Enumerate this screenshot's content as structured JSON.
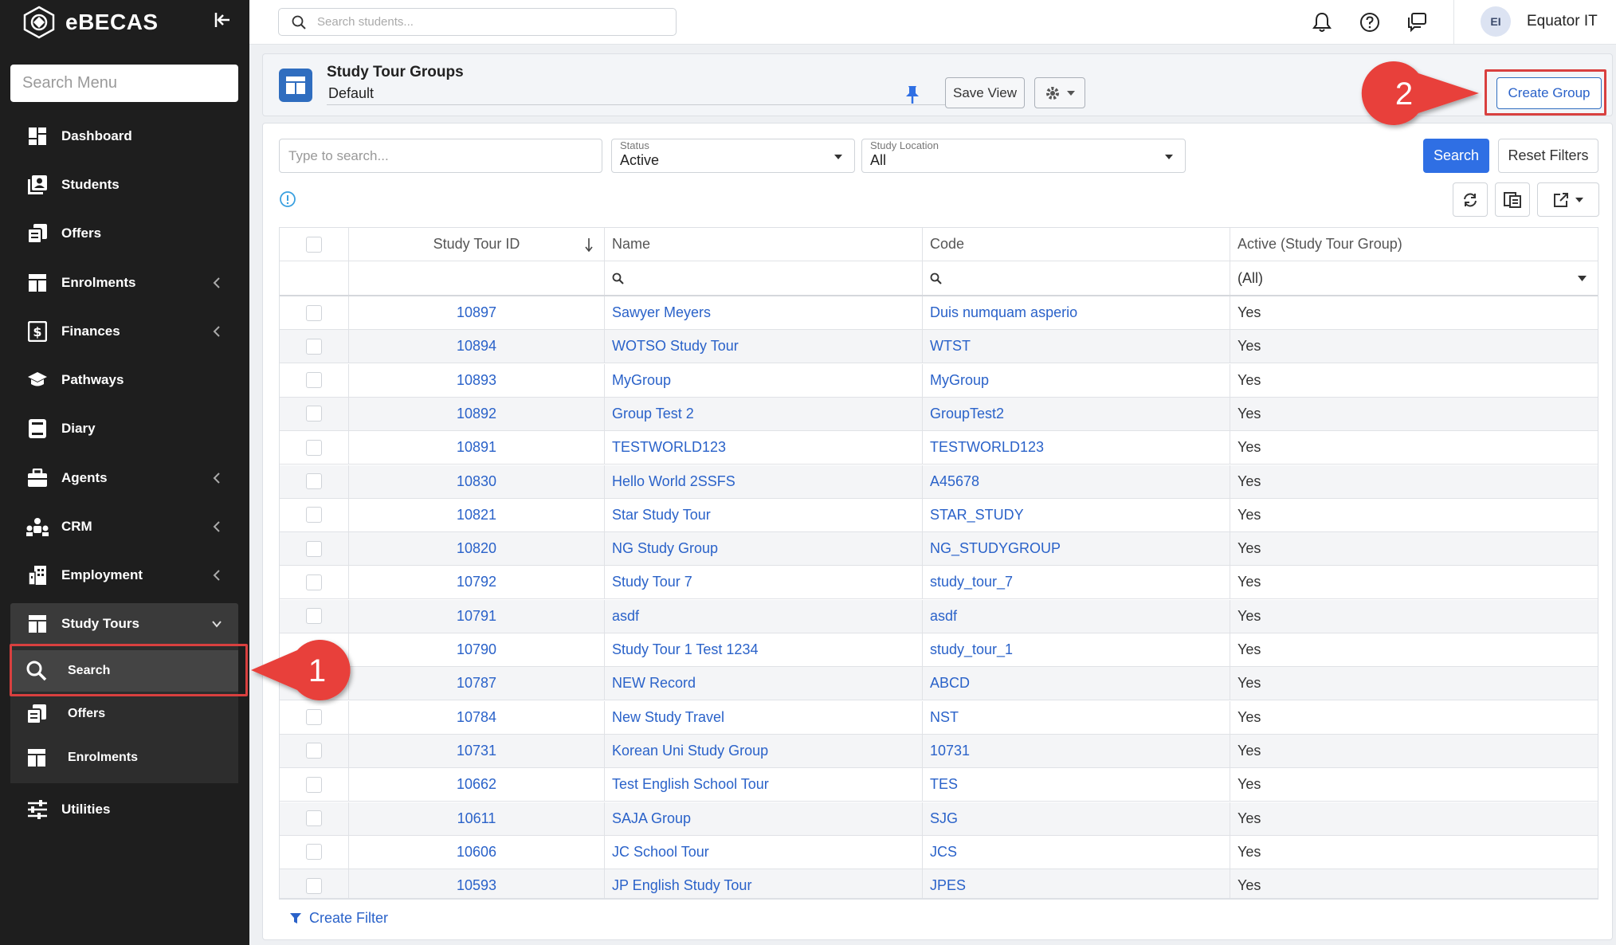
{
  "app": {
    "brand_name": "eBECAS",
    "menu_search_placeholder": "Search Menu"
  },
  "sidebar": {
    "items": [
      {
        "label": "Dashboard",
        "icon": "dashboard-icon"
      },
      {
        "label": "Students",
        "icon": "students-icon"
      },
      {
        "label": "Offers",
        "icon": "offers-icon"
      },
      {
        "label": "Enrolments",
        "icon": "enrolments-icon",
        "expandable": true
      },
      {
        "label": "Finances",
        "icon": "finances-icon",
        "expandable": true
      },
      {
        "label": "Pathways",
        "icon": "graduation-cap-icon"
      },
      {
        "label": "Diary",
        "icon": "diary-icon"
      },
      {
        "label": "Agents",
        "icon": "briefcase-icon",
        "expandable": true
      },
      {
        "label": "CRM",
        "icon": "crm-icon",
        "expandable": true
      },
      {
        "label": "Employment",
        "icon": "building-icon",
        "expandable": true
      },
      {
        "label": "Study Tours",
        "icon": "study-tours-icon",
        "expanded": true
      },
      {
        "label": "Utilities",
        "icon": "sliders-icon"
      }
    ],
    "study_tours_sub": [
      {
        "label": "Search",
        "icon": "search-icon",
        "active": true
      },
      {
        "label": "Offers",
        "icon": "offers-icon"
      },
      {
        "label": "Enrolments",
        "icon": "enrolments-icon"
      }
    ]
  },
  "topbar": {
    "search_placeholder": "Search students...",
    "user_initials": "EI",
    "user_name": "Equator IT"
  },
  "header": {
    "title": "Study Tour Groups",
    "view_name": "Default",
    "save_view_label": "Save View",
    "create_group_label": "Create Group"
  },
  "filters": {
    "search_placeholder": "Type to search...",
    "status_label": "Status",
    "status_value": "Active",
    "location_label": "Study Location",
    "location_value": "All",
    "search_button": "Search",
    "reset_button": "Reset Filters"
  },
  "grid": {
    "columns": [
      "Study Tour ID",
      "Name",
      "Code",
      "Active (Study Tour Group)"
    ],
    "active_filter_value": "(All)",
    "rows": [
      {
        "id": "10897",
        "name": "Sawyer Meyers",
        "code": "Duis numquam asperio",
        "active": "Yes"
      },
      {
        "id": "10894",
        "name": "WOTSO Study Tour",
        "code": "WTST",
        "active": "Yes"
      },
      {
        "id": "10893",
        "name": "MyGroup",
        "code": "MyGroup",
        "active": "Yes"
      },
      {
        "id": "10892",
        "name": "Group Test 2",
        "code": "GroupTest2",
        "active": "Yes"
      },
      {
        "id": "10891",
        "name": "TESTWORLD123",
        "code": "TESTWORLD123",
        "active": "Yes"
      },
      {
        "id": "10830",
        "name": "Hello World 2SSFS",
        "code": "A45678",
        "active": "Yes"
      },
      {
        "id": "10821",
        "name": "Star Study Tour",
        "code": "STAR_STUDY",
        "active": "Yes"
      },
      {
        "id": "10820",
        "name": "NG Study Group",
        "code": "NG_STUDYGROUP",
        "active": "Yes"
      },
      {
        "id": "10792",
        "name": "Study Tour 7",
        "code": "study_tour_7",
        "active": "Yes"
      },
      {
        "id": "10791",
        "name": "asdf",
        "code": "asdf",
        "active": "Yes"
      },
      {
        "id": "10790",
        "name": "Study Tour 1 Test 1234",
        "code": "study_tour_1",
        "active": "Yes"
      },
      {
        "id": "10787",
        "name": "NEW Record",
        "code": "ABCD",
        "active": "Yes"
      },
      {
        "id": "10784",
        "name": "New Study Travel",
        "code": "NST",
        "active": "Yes"
      },
      {
        "id": "10731",
        "name": "Korean Uni Study Group",
        "code": "10731",
        "active": "Yes"
      },
      {
        "id": "10662",
        "name": "Test English School Tour",
        "code": "TES",
        "active": "Yes"
      },
      {
        "id": "10611",
        "name": "SAJA Group",
        "code": "SJG",
        "active": "Yes"
      },
      {
        "id": "10606",
        "name": "JC School Tour",
        "code": "JCS",
        "active": "Yes"
      },
      {
        "id": "10593",
        "name": "JP English Study Tour",
        "code": "JPES",
        "active": "Yes"
      }
    ],
    "footer_label": "Create Filter"
  },
  "callouts": [
    {
      "number": "1"
    },
    {
      "number": "2"
    }
  ],
  "colors": {
    "sidebar_bg": "#1e1e1e",
    "accent_blue": "#2f6fe4",
    "link_blue": "#2a62c9",
    "callout_red": "#e8413b",
    "highlight_border": "#d9403f"
  }
}
